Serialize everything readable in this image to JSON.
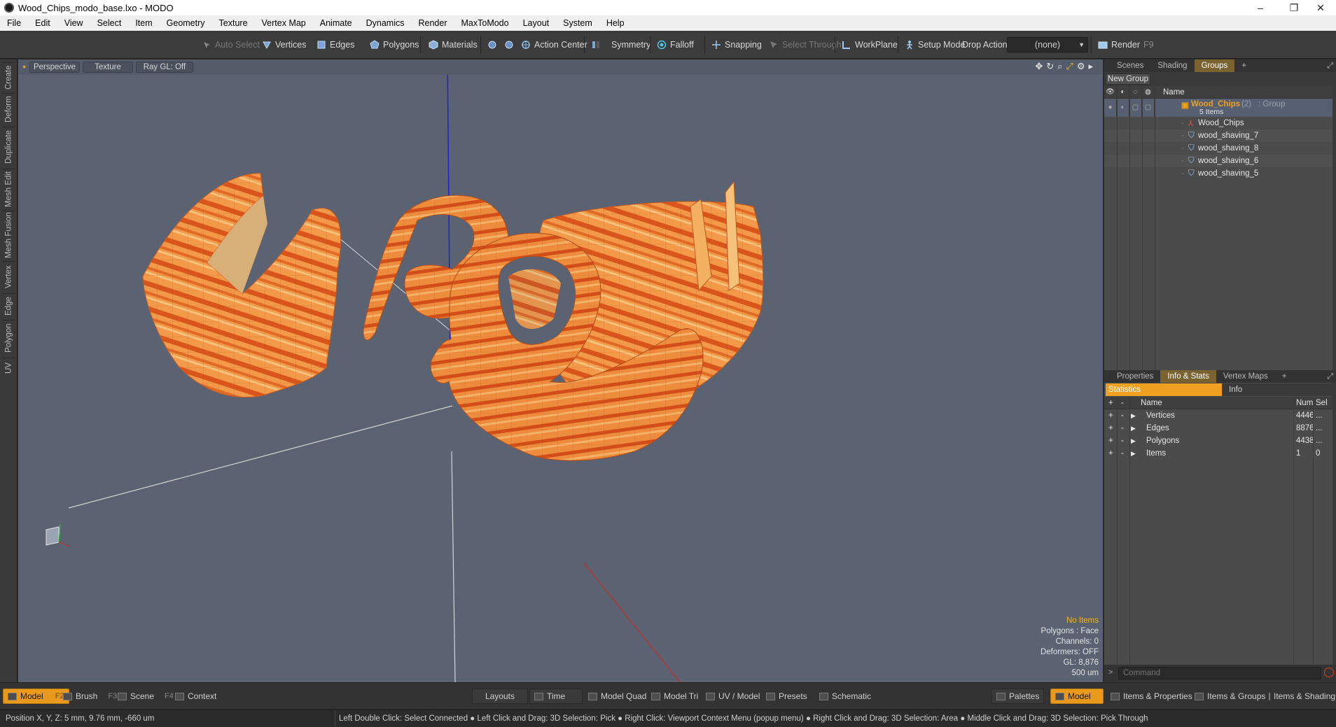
{
  "window": {
    "title": "Wood_Chips_modo_base.lxo - MODO",
    "minimize": "–",
    "restore": "❐",
    "close": "✕"
  },
  "menu": [
    "File",
    "Edit",
    "View",
    "Select",
    "Item",
    "Geometry",
    "Texture",
    "Vertex Map",
    "Animate",
    "Dynamics",
    "Render",
    "MaxToModo",
    "Layout",
    "System",
    "Help"
  ],
  "toolbar": {
    "auto_select": "Auto Select",
    "vertices": "Vertices",
    "edges": "Edges",
    "polygons": "Polygons",
    "materials": "Materials",
    "action_center": "Action Center",
    "symmetry": "Symmetry",
    "falloff": "Falloff",
    "snapping": "Snapping",
    "select_through": "Select Through",
    "workplane": "WorkPlane",
    "setup_mode": "Setup Mode",
    "drop_action_label": "Drop Action",
    "drop_action_value": "(none)",
    "render": "Render",
    "render_key": "F9"
  },
  "left_tabs": [
    "Create",
    "Deform",
    "Duplicate",
    "Mesh Edit",
    "Mesh Fusion",
    "Vertex",
    "Edge",
    "Polygon",
    "UV"
  ],
  "viewport": {
    "tabs": [
      "Perspective",
      "Texture",
      "Ray GL: Off"
    ],
    "info": {
      "selection": "No Items",
      "polygons": "Polygons : Face",
      "channels": "Channels: 0",
      "deformers": "Deformers: OFF",
      "gl": "GL: 8,876",
      "scale": "500 um"
    },
    "colors": {
      "background": "#5b6373",
      "wood_light": "#f09a4a",
      "wood_dark": "#d8521a",
      "axis_x": "#c0302a",
      "axis_y": "#2dbd3a",
      "axis_z": "#2020d0"
    }
  },
  "groups_panel": {
    "tabs": [
      "Scenes",
      "Shading",
      "Groups"
    ],
    "add": "+",
    "new_group": "New Group",
    "column_name": "Name",
    "group": {
      "name": "Wood_Chips",
      "count": "(2)",
      "type": ": Group",
      "items_count": "5 Items"
    },
    "items": [
      "Wood_Chips",
      "wood_shaving_7",
      "wood_shaving_8",
      "wood_shaving_6",
      "wood_shaving_5"
    ]
  },
  "stats_panel": {
    "tabs": [
      "Properties",
      "Info & Stats",
      "Vertex Maps"
    ],
    "add": "+",
    "subtabs": [
      "Statistics",
      "Info"
    ],
    "columns": {
      "name": "Name",
      "num": "Num",
      "sel": "Sel"
    },
    "rows": [
      {
        "name": "Vertices",
        "num": "4446",
        "sel": "..."
      },
      {
        "name": "Edges",
        "num": "8876",
        "sel": "..."
      },
      {
        "name": "Polygons",
        "num": "4438",
        "sel": "..."
      },
      {
        "name": "Items",
        "num": "1",
        "sel": "0"
      }
    ]
  },
  "command": {
    "placeholder": "Command"
  },
  "bottom": {
    "model": "Model",
    "model_key": "F2",
    "brush": "Brush",
    "brush_key": "F3",
    "scene": "Scene",
    "scene_key": "F4",
    "context": "Context",
    "layouts": "Layouts",
    "time": "Time",
    "model_quad": "Model Quad",
    "model_tri": "Model Tri",
    "uv_model": "UV / Model",
    "presets": "Presets",
    "schematic": "Schematic",
    "palettes": "Palettes",
    "model_right": "Model",
    "items_properties": "Items & Properties",
    "items_groups": "Items & Groups",
    "items_shading": "Items & Shading"
  },
  "status": {
    "position": "Position X, Y, Z:  5 mm, 9.76 mm, -660 um",
    "hints": "Left Double Click: Select Connected ● Left Click and Drag: 3D Selection: Pick ● Right Click: Viewport Context Menu (popup menu) ● Right Click and Drag: 3D Selection: Area ● Middle Click and Drag: 3D Selection: Pick Through"
  }
}
